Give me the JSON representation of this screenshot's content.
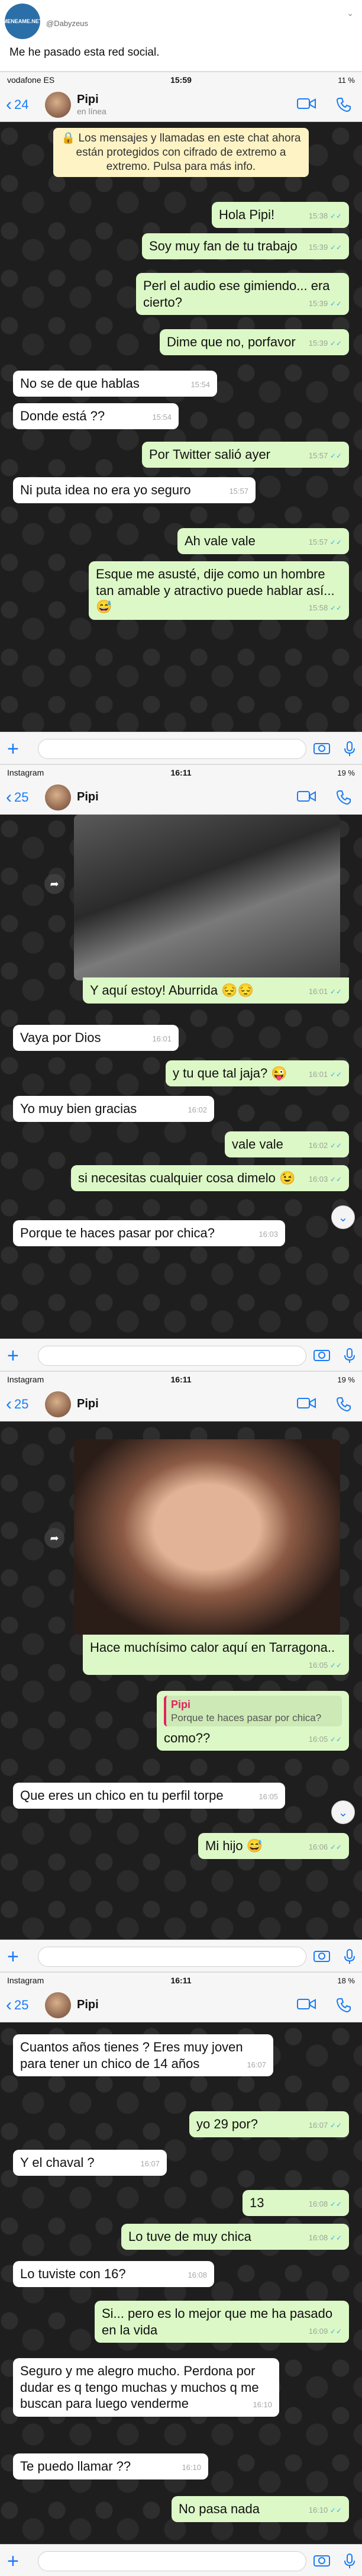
{
  "tweet": {
    "avatar_text": "MENEAME.NET",
    "name": "",
    "handle": "@Dabyzeus",
    "text": "Me he pasado esta red social."
  },
  "shot1": {
    "status": {
      "carrier": "vodafone ES",
      "time": "15:59",
      "battery": "11 %"
    },
    "back_count": "24",
    "contact_name": "Pipi",
    "contact_status": "en línea",
    "notice": "Los mensajes y llamadas en este chat ahora están protegidos con cifrado de extremo a extremo. Pulsa para más info.",
    "messages": [
      {
        "text": "Hola Pipi!",
        "time": "15:38"
      },
      {
        "text": "Soy muy fan de tu trabajo",
        "time": "15:39"
      },
      {
        "text": "Perl el audio ese gimiendo... era cierto?",
        "time": "15:39"
      },
      {
        "text": "Dime que no, porfavor",
        "time": "15:39"
      },
      {
        "text": "No se de que hablas",
        "time": "15:54"
      },
      {
        "text": "Donde está ??",
        "time": "15:54"
      },
      {
        "text": "Por Twitter salió ayer",
        "time": "15:57"
      },
      {
        "text": "Ni puta idea no era yo seguro",
        "time": "15:57"
      },
      {
        "text": "Ah vale vale",
        "time": "15:57"
      },
      {
        "text": "Esque me asusté, dije como un hombre tan amable y atractivo puede hablar así... 😅",
        "time": "15:58"
      }
    ]
  },
  "shot2": {
    "status": {
      "carrier": "Instagram",
      "time": "16:11",
      "battery": "19 %"
    },
    "back_count": "25",
    "contact_name": "Pipi",
    "messages": [
      {
        "text": "Y aquí estoy! Aburrida 😔😔",
        "time": "16:01"
      },
      {
        "text": "Vaya por Dios",
        "time": "16:01"
      },
      {
        "text": "y tu que tal jaja? 😜",
        "time": "16:01"
      },
      {
        "text": "Yo muy bien gracias",
        "time": "16:02"
      },
      {
        "text": "vale vale",
        "time": "16:02"
      },
      {
        "text": "si necesitas cualquier cosa dimelo 😉",
        "time": "16:03"
      },
      {
        "text": "Porque te haces pasar por chica?",
        "time": "16:03"
      }
    ]
  },
  "shot3": {
    "status": {
      "carrier": "Instagram",
      "time": "16:11",
      "battery": "19 %"
    },
    "back_count": "25",
    "contact_name": "Pipi",
    "messages": [
      {
        "text": "Hace muchísimo calor aquí en Tarragona..",
        "time": "16:05"
      },
      {
        "text": "como??",
        "time": "16:05",
        "quote_name": "Pipi",
        "quote_text": "Porque te haces pasar por chica?"
      },
      {
        "text": "Que eres un chico en tu perfil torpe",
        "time": "16:05"
      },
      {
        "text": "Mi hijo 😅",
        "time": "16:06"
      }
    ]
  },
  "shot4": {
    "status": {
      "carrier": "Instagram",
      "time": "16:11",
      "battery": "18 %"
    },
    "back_count": "25",
    "contact_name": "Pipi",
    "messages": [
      {
        "text": "Cuantos años tienes ? Eres muy joven para tener un chico de 14 años",
        "time": "16:07"
      },
      {
        "text": "yo 29 por?",
        "time": "16:07"
      },
      {
        "text": "Y el chaval ?",
        "time": "16:07"
      },
      {
        "text": "13",
        "time": "16:08"
      },
      {
        "text": "Lo tuve de muy chica",
        "time": "16:08"
      },
      {
        "text": "Lo tuviste con 16?",
        "time": "16:08"
      },
      {
        "text": "Si... pero es lo mejor que me ha pasado en la vida",
        "time": "16:09"
      },
      {
        "text": "Seguro y me alegro mucho. Perdona por dudar es q tengo muchas y muchos q me buscan para luego venderme",
        "time": "16:10"
      },
      {
        "text": "Te puedo llamar ??",
        "time": "16:10"
      },
      {
        "text": "No pasa nada",
        "time": "16:10"
      }
    ]
  },
  "ticks": "✓✓"
}
